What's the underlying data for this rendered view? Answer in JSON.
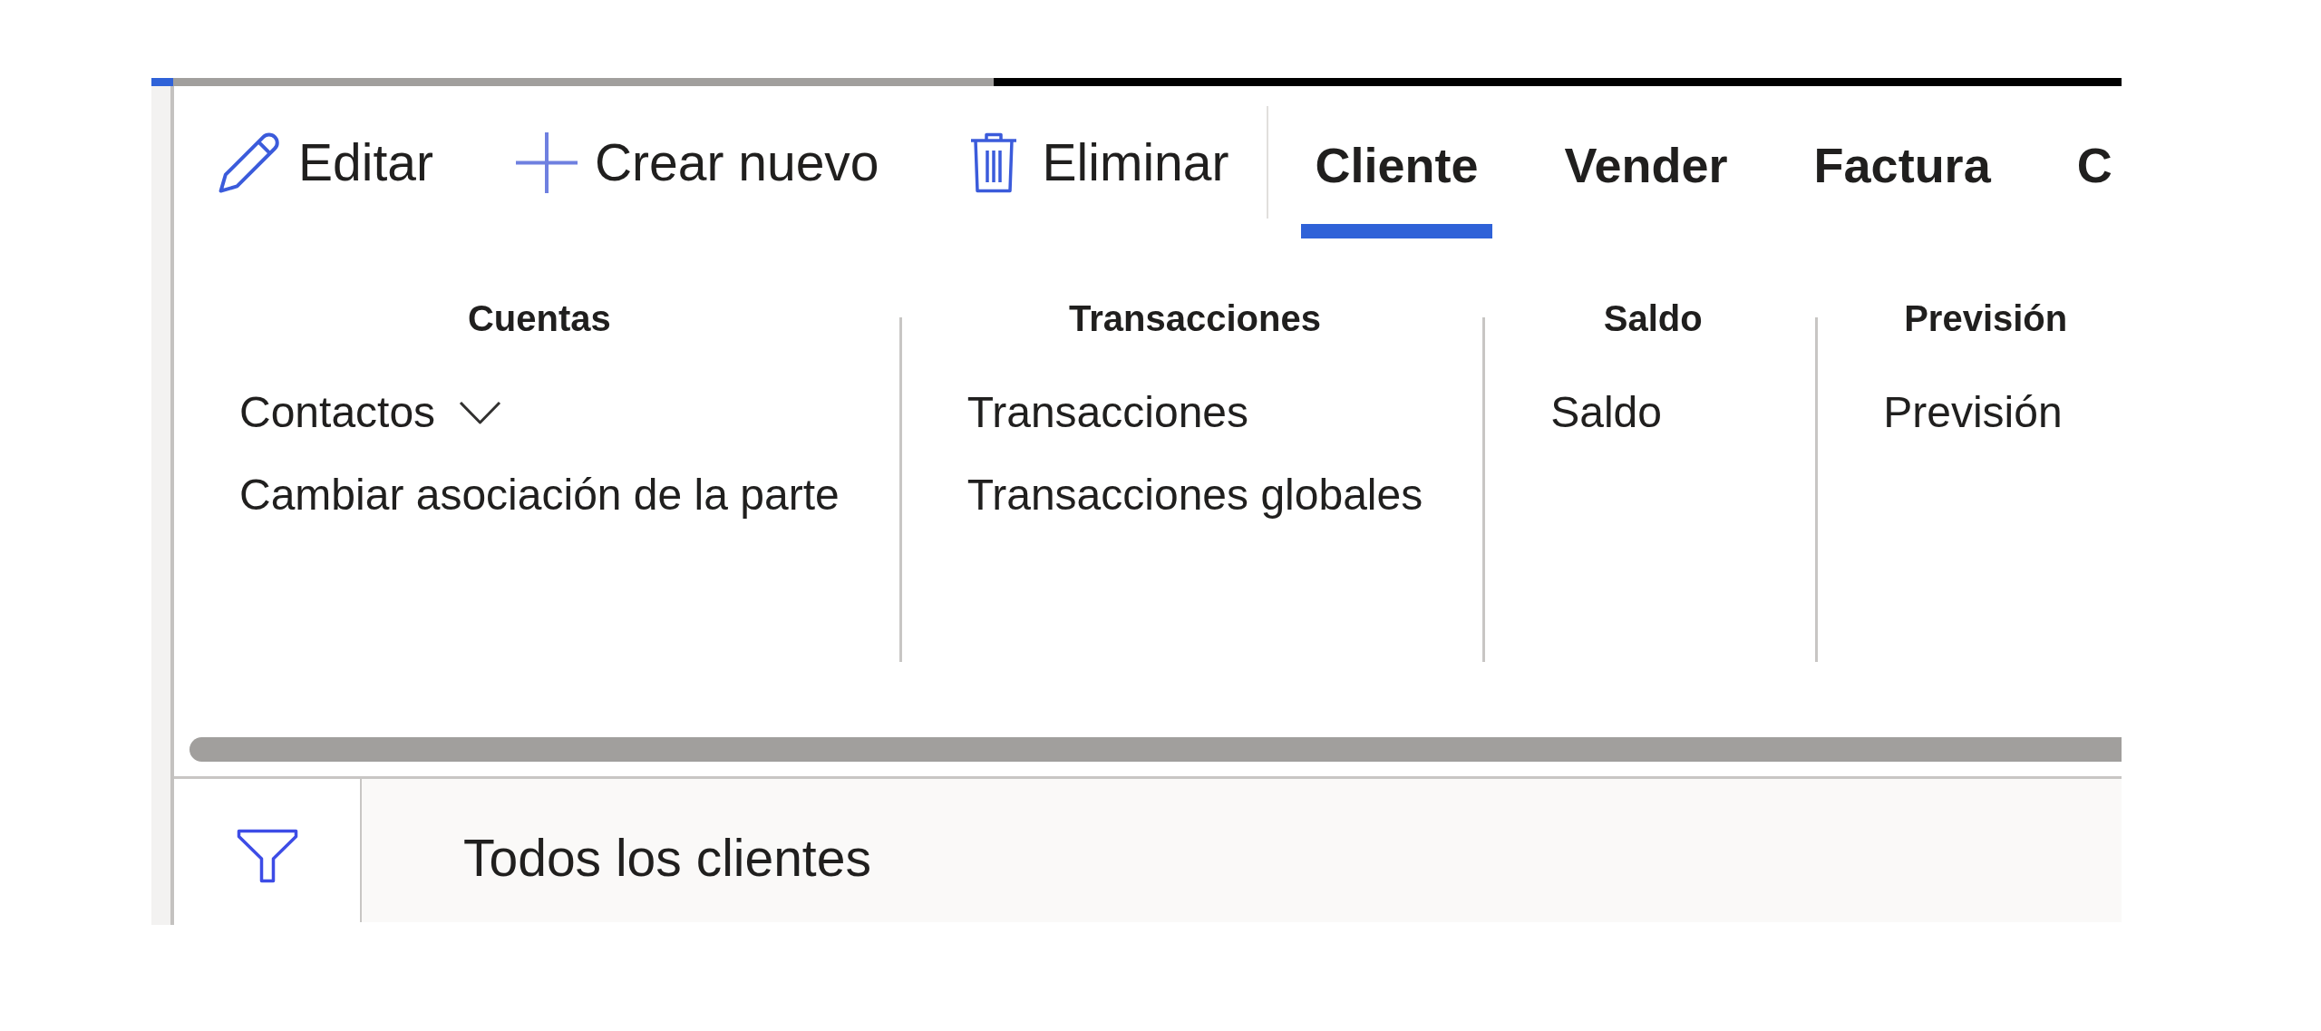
{
  "toolbar": {
    "actions": [
      {
        "label": "Editar",
        "kind": "edit"
      },
      {
        "label": "Crear nuevo",
        "kind": "new"
      },
      {
        "label": "Eliminar",
        "kind": "delete"
      }
    ],
    "tabs": [
      {
        "label": "Cliente",
        "selected": true
      },
      {
        "label": "Vender",
        "selected": false
      },
      {
        "label": "Factura",
        "selected": false
      },
      {
        "label": "C",
        "selected": false
      }
    ]
  },
  "ribbon_groups": [
    {
      "title": "Cuentas",
      "items": [
        {
          "label": "Contactos",
          "kind": "dropdown"
        },
        {
          "label": "Cambiar asociación de la parte",
          "kind": "command"
        }
      ]
    },
    {
      "title": "Transacciones",
      "items": [
        {
          "label": "Transacciones",
          "kind": "command"
        },
        {
          "label": "Transacciones globales",
          "kind": "command"
        }
      ]
    },
    {
      "title": "Saldo",
      "items": [
        {
          "label": "Saldo",
          "kind": "command"
        }
      ]
    },
    {
      "title": "Previsión",
      "items": [
        {
          "label": "Previsión",
          "kind": "command"
        }
      ]
    }
  ],
  "filter_bar": {
    "view_title": "Todos los clientes"
  }
}
